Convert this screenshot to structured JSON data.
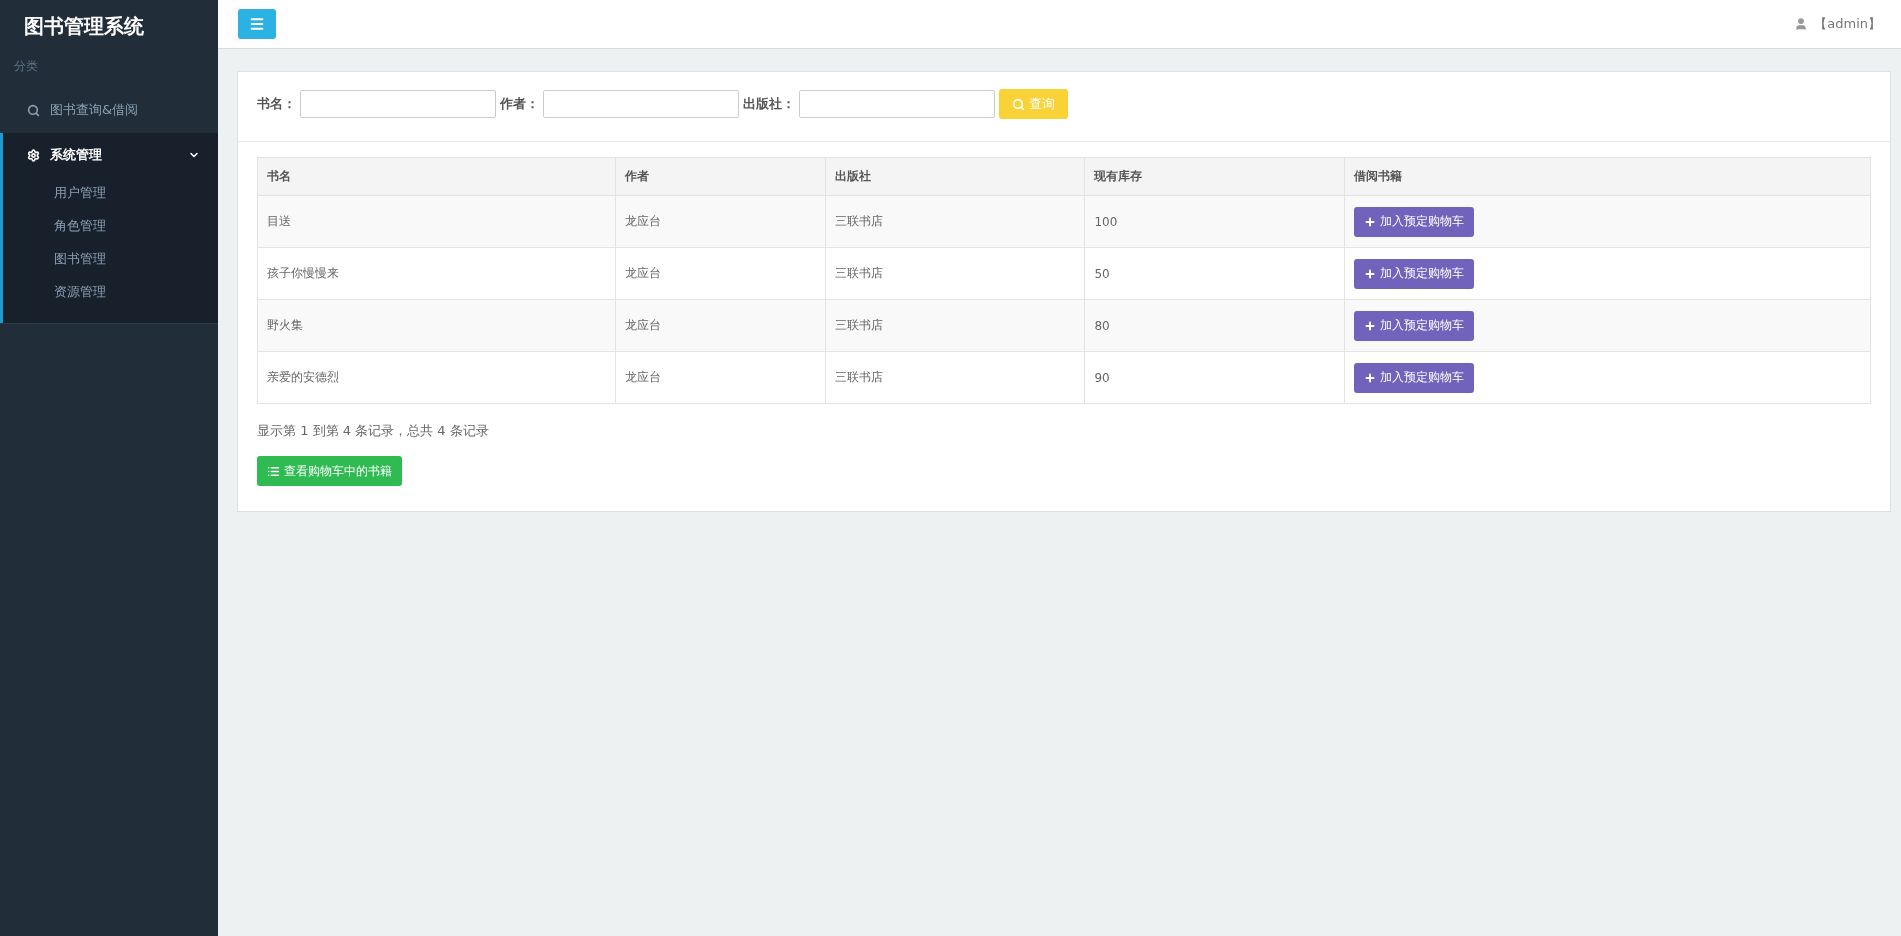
{
  "sidebar": {
    "title": "图书管理系统",
    "section_label": "分类",
    "items": [
      {
        "label": "图书查询&借阅",
        "expanded": false
      },
      {
        "label": "系统管理",
        "expanded": true,
        "children": [
          {
            "label": "用户管理"
          },
          {
            "label": "角色管理"
          },
          {
            "label": "图书管理"
          },
          {
            "label": "资源管理"
          }
        ]
      }
    ]
  },
  "header": {
    "user": "【admin】"
  },
  "search": {
    "fields": [
      {
        "label": "书名："
      },
      {
        "label": "作者："
      },
      {
        "label": "出版社："
      }
    ],
    "button": "查询"
  },
  "table": {
    "columns": [
      "书名",
      "作者",
      "出版社",
      "现有库存",
      "借阅书籍"
    ],
    "rows": [
      {
        "cells": [
          "目送",
          "龙应台",
          "三联书店",
          "100"
        ],
        "action": "加入预定购物车"
      },
      {
        "cells": [
          "孩子你慢慢来",
          "龙应台",
          "三联书店",
          "50"
        ],
        "action": "加入预定购物车"
      },
      {
        "cells": [
          "野火集",
          "龙应台",
          "三联书店",
          "80"
        ],
        "action": "加入预定购物车"
      },
      {
        "cells": [
          "亲爱的安德烈",
          "龙应台",
          "三联书店",
          "90"
        ],
        "action": "加入预定购物车"
      }
    ]
  },
  "pagination_info": "显示第 1 到第 4 条记录，总共 4 条记录",
  "cart_button": "查看购物车中的书籍"
}
